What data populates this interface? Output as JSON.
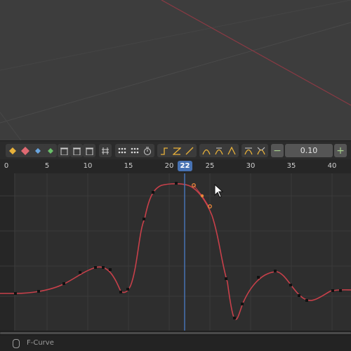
{
  "graph_editor": {
    "timeline": {
      "frame_labels": [
        "0",
        "5",
        "10",
        "15",
        "20",
        "25",
        "30",
        "35",
        "40"
      ],
      "current_frame": "22"
    },
    "toolbar": {
      "value_field": "0.10",
      "minus_label": "−",
      "plus_label": "+"
    },
    "status_bar": {
      "label": "F-Curve"
    },
    "colors": {
      "curve": "#c8404a",
      "keyframe": "#111111",
      "selected_keyframe": "#e8873a",
      "playhead": "#4772b3",
      "viewport_line": "#b04050"
    },
    "icons": [
      "keyframe-diamond-icon",
      "insert-keyframe-icon",
      "delete-keyframe-icon",
      "snap-icon",
      "interpolation-icon",
      "easing-icon",
      "timer-icon"
    ]
  }
}
